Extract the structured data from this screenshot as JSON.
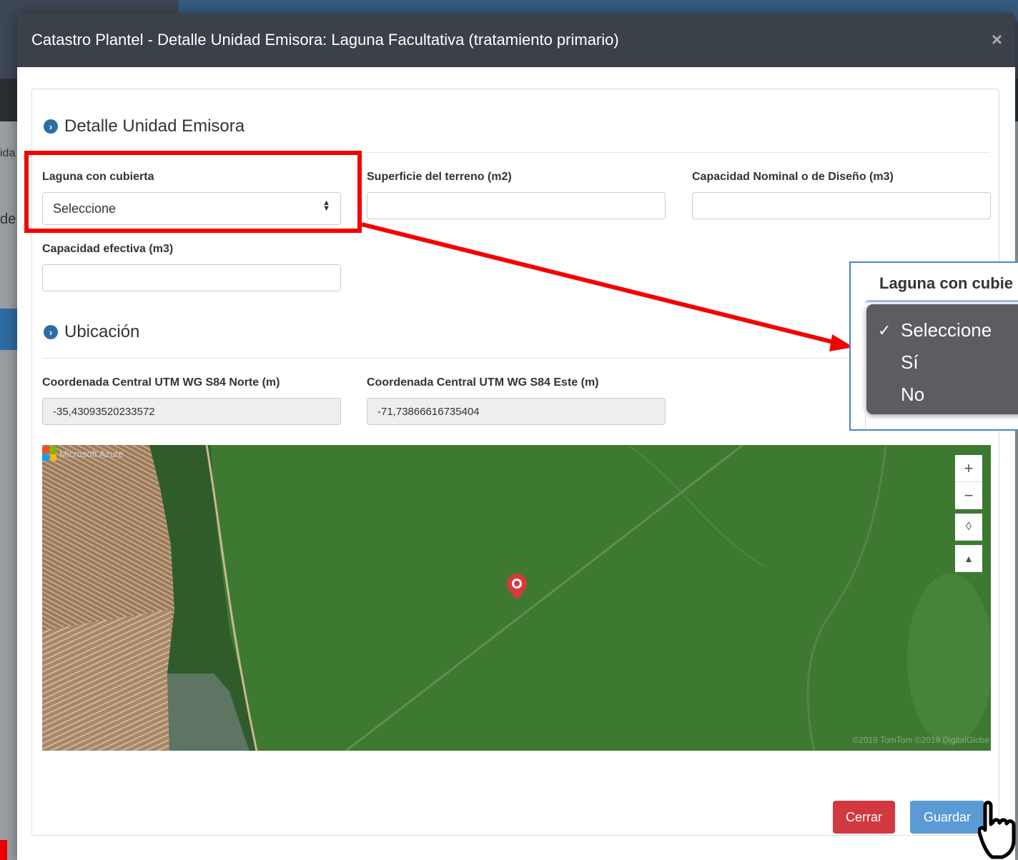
{
  "background": {
    "text_a": "ida",
    "text_b": "de"
  },
  "modal": {
    "title": "Catastro Plantel - Detalle Unidad Emisora: Laguna Facultativa (tratamiento primario)",
    "close_label": "×"
  },
  "section_detalle": {
    "title": "Detalle Unidad Emisora",
    "icon": "chevron-right-circle-icon",
    "fields": {
      "laguna": {
        "label": "Laguna con cubierta",
        "value": "Seleccione",
        "options": [
          "Seleccione",
          "Sí",
          "No"
        ]
      },
      "superficie": {
        "label": "Superficie del terreno (m2)",
        "value": ""
      },
      "capacidad_nominal": {
        "label": "Capacidad Nominal o de Diseño (m3)",
        "value": ""
      },
      "capacidad_efectiva": {
        "label": "Capacidad efectiva (m3)",
        "value": ""
      }
    }
  },
  "section_ubicacion": {
    "title": "Ubicación",
    "icon": "chevron-right-circle-icon",
    "fields": {
      "norte": {
        "label": "Coordenada Central UTM WG S84 Norte (m)",
        "value": "-35,43093520233572"
      },
      "este": {
        "label": "Coordenada Central UTM WG S84 Este (m)",
        "value": "-71,73866616735404"
      }
    }
  },
  "map": {
    "brand": "Microsoft Azure",
    "copyright": "©2019 TomTom ©2019 DigitalGlobe",
    "controls": {
      "zoom_in": "+",
      "zoom_out": "−",
      "compass": "◊",
      "pitch": "▲"
    }
  },
  "buttons": {
    "cerrar": "Cerrar",
    "guardar": "Guardar"
  },
  "callout": {
    "label": "Laguna con cubie",
    "checkmark": "✓",
    "options": [
      "Seleccione",
      "Sí",
      "No"
    ]
  },
  "colors": {
    "header": "#3b4148",
    "accent": "#2e6da4",
    "danger": "#d2383f",
    "primary": "#5b9bd5",
    "highlight": "#f40000"
  }
}
